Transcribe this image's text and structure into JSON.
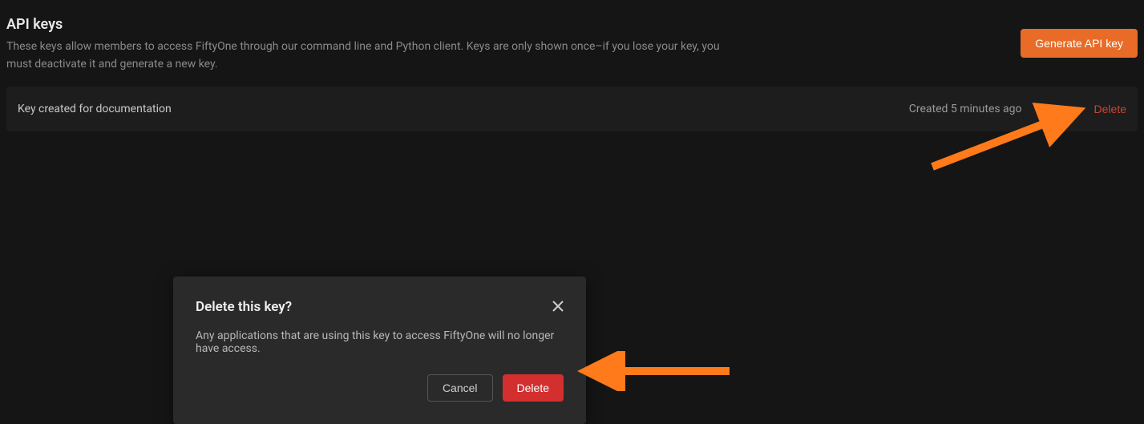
{
  "header": {
    "title": "API keys",
    "description": "These keys allow members to access FiftyOne through our command line and Python client. Keys are only shown once–if you lose your key, you must deactivate it and generate a new key.",
    "generate_label": "Generate API key"
  },
  "keys": [
    {
      "name": "Key created for documentation",
      "created": "Created 5 minutes ago",
      "delete_label": "Delete"
    }
  ],
  "modal": {
    "title": "Delete this key?",
    "body": "Any applications that are using this key to access FiftyOne will no longer have access.",
    "cancel_label": "Cancel",
    "delete_label": "Delete"
  },
  "colors": {
    "accent": "#e86c27",
    "danger": "#d32f2f"
  }
}
